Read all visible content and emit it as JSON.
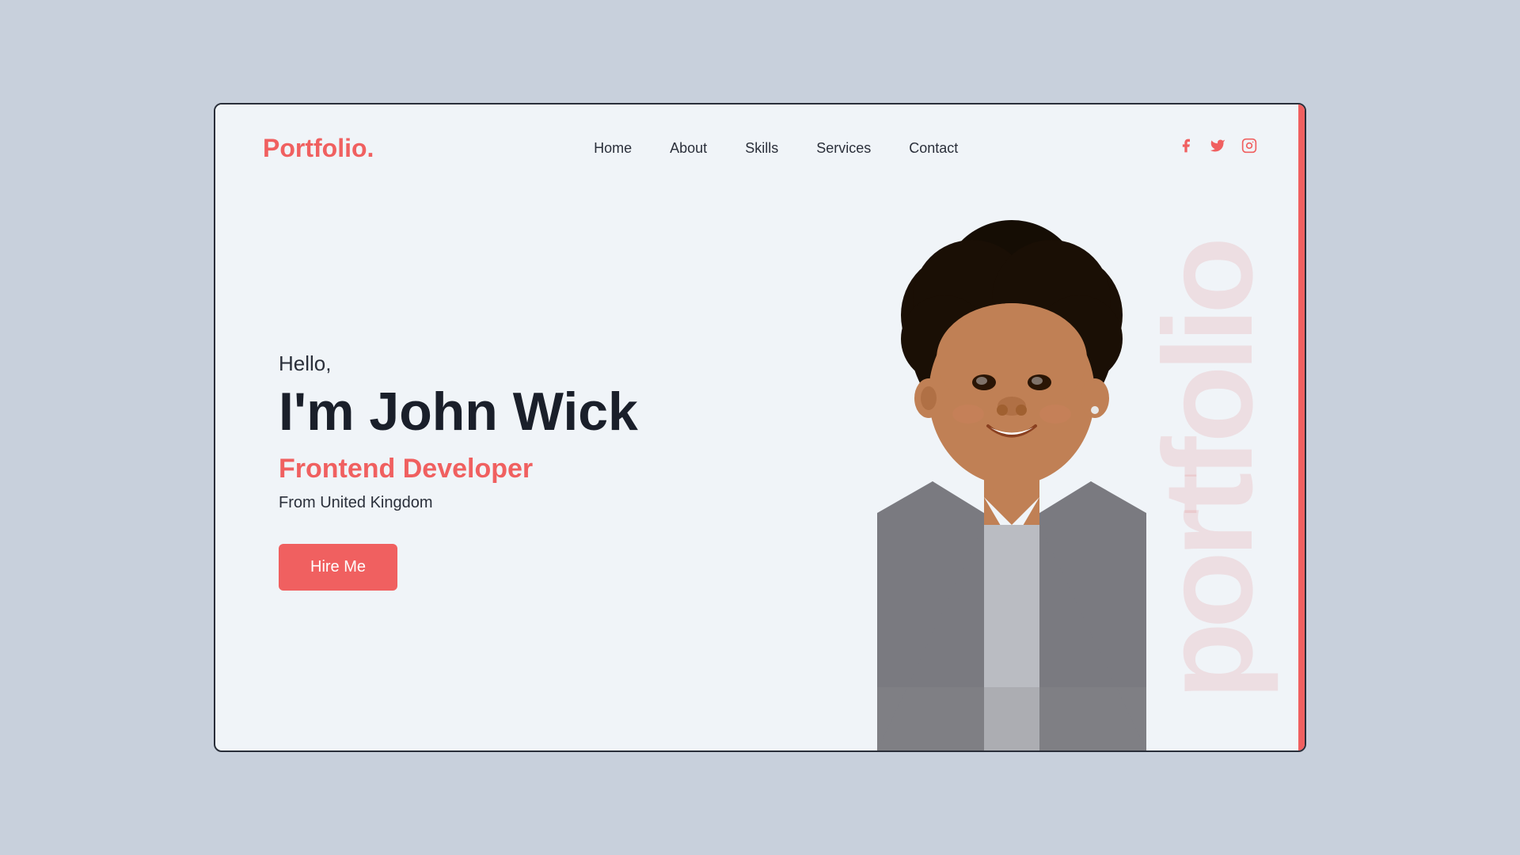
{
  "brand": {
    "logo_text": "Portfolio.",
    "logo_dot": "."
  },
  "navbar": {
    "links": [
      {
        "label": "Home",
        "id": "nav-home"
      },
      {
        "label": "About",
        "id": "nav-about"
      },
      {
        "label": "Skills",
        "id": "nav-skills"
      },
      {
        "label": "Services",
        "id": "nav-services"
      },
      {
        "label": "Contact",
        "id": "nav-contact"
      }
    ],
    "social": [
      {
        "label": "Facebook",
        "icon": "f",
        "id": "social-facebook"
      },
      {
        "label": "Twitter",
        "icon": "t",
        "id": "social-twitter"
      },
      {
        "label": "Instagram",
        "icon": "i",
        "id": "social-instagram"
      }
    ]
  },
  "hero": {
    "greeting": "Hello,",
    "name": "I'm John Wick",
    "role": "Frontend Developer",
    "location": "From United Kingdom",
    "cta_button": "Hire Me",
    "watermark": "portfolio"
  },
  "colors": {
    "accent": "#f06060",
    "dark": "#1a1f2a",
    "bg": "#f0f4f8"
  }
}
